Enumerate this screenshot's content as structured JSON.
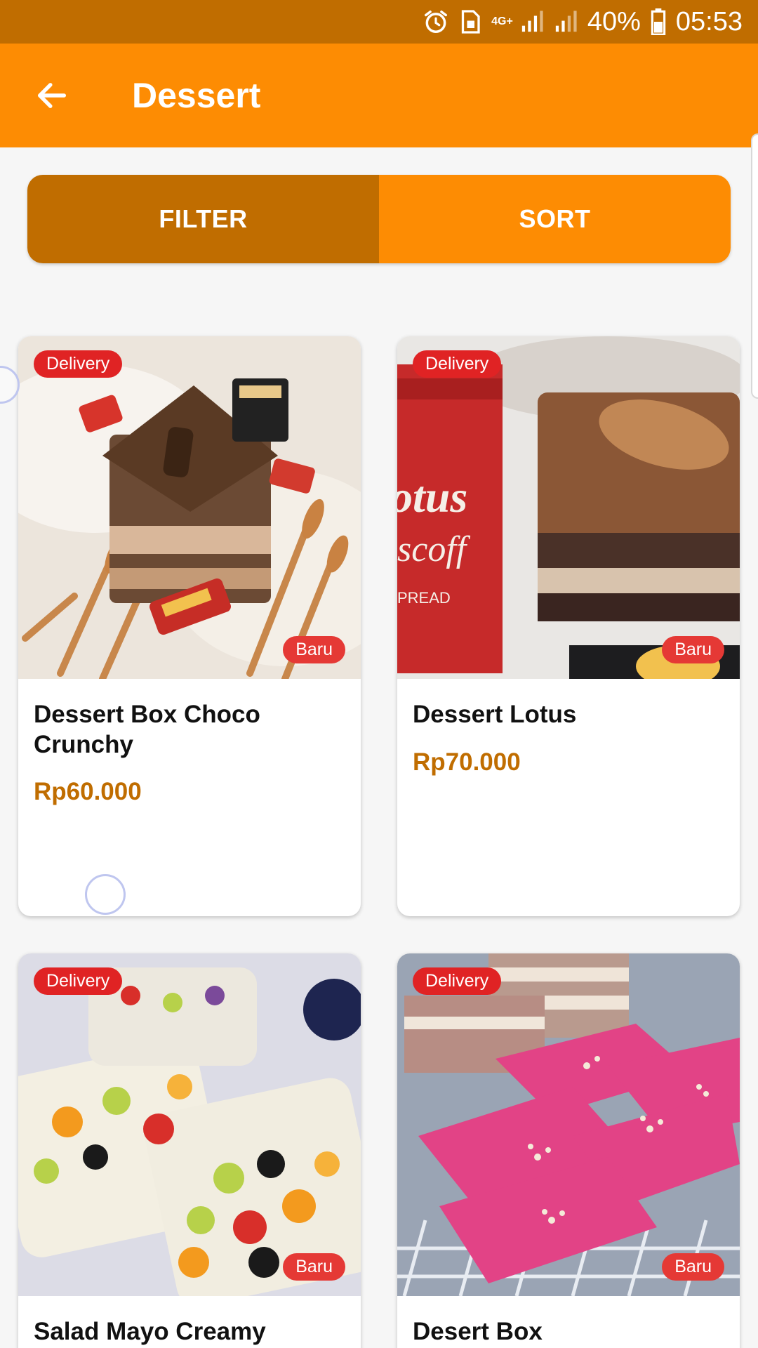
{
  "status_bar": {
    "network": "4G+",
    "battery": "40%",
    "time": "05:53",
    "icons": [
      "alarm-icon",
      "sim-icon",
      "signal-icon",
      "signal-icon",
      "battery-icon"
    ]
  },
  "app_bar": {
    "back_icon": "arrow-left-icon",
    "title": "Dessert"
  },
  "toolbar": {
    "filter_label": "FILTER",
    "sort_label": "SORT"
  },
  "products": [
    {
      "name": "Dessert Box Choco Crunchy",
      "price": "Rp60.000",
      "delivery_badge": "Delivery",
      "new_badge": "Baru"
    },
    {
      "name": "Dessert Lotus",
      "price": "Rp70.000",
      "delivery_badge": "Delivery",
      "new_badge": "Baru"
    },
    {
      "name": "Salad Mayo Creamy",
      "price": "",
      "delivery_badge": "Delivery",
      "new_badge": "Baru"
    },
    {
      "name": "Desert Box",
      "price": "",
      "delivery_badge": "Delivery",
      "new_badge": "Baru"
    }
  ],
  "colors": {
    "status_bar": "#c06d00",
    "app_bar": "#fd8c03",
    "filter_button": "#c06d00",
    "sort_button": "#fd8c03",
    "price": "#c06d00",
    "badge": "#e02324"
  }
}
